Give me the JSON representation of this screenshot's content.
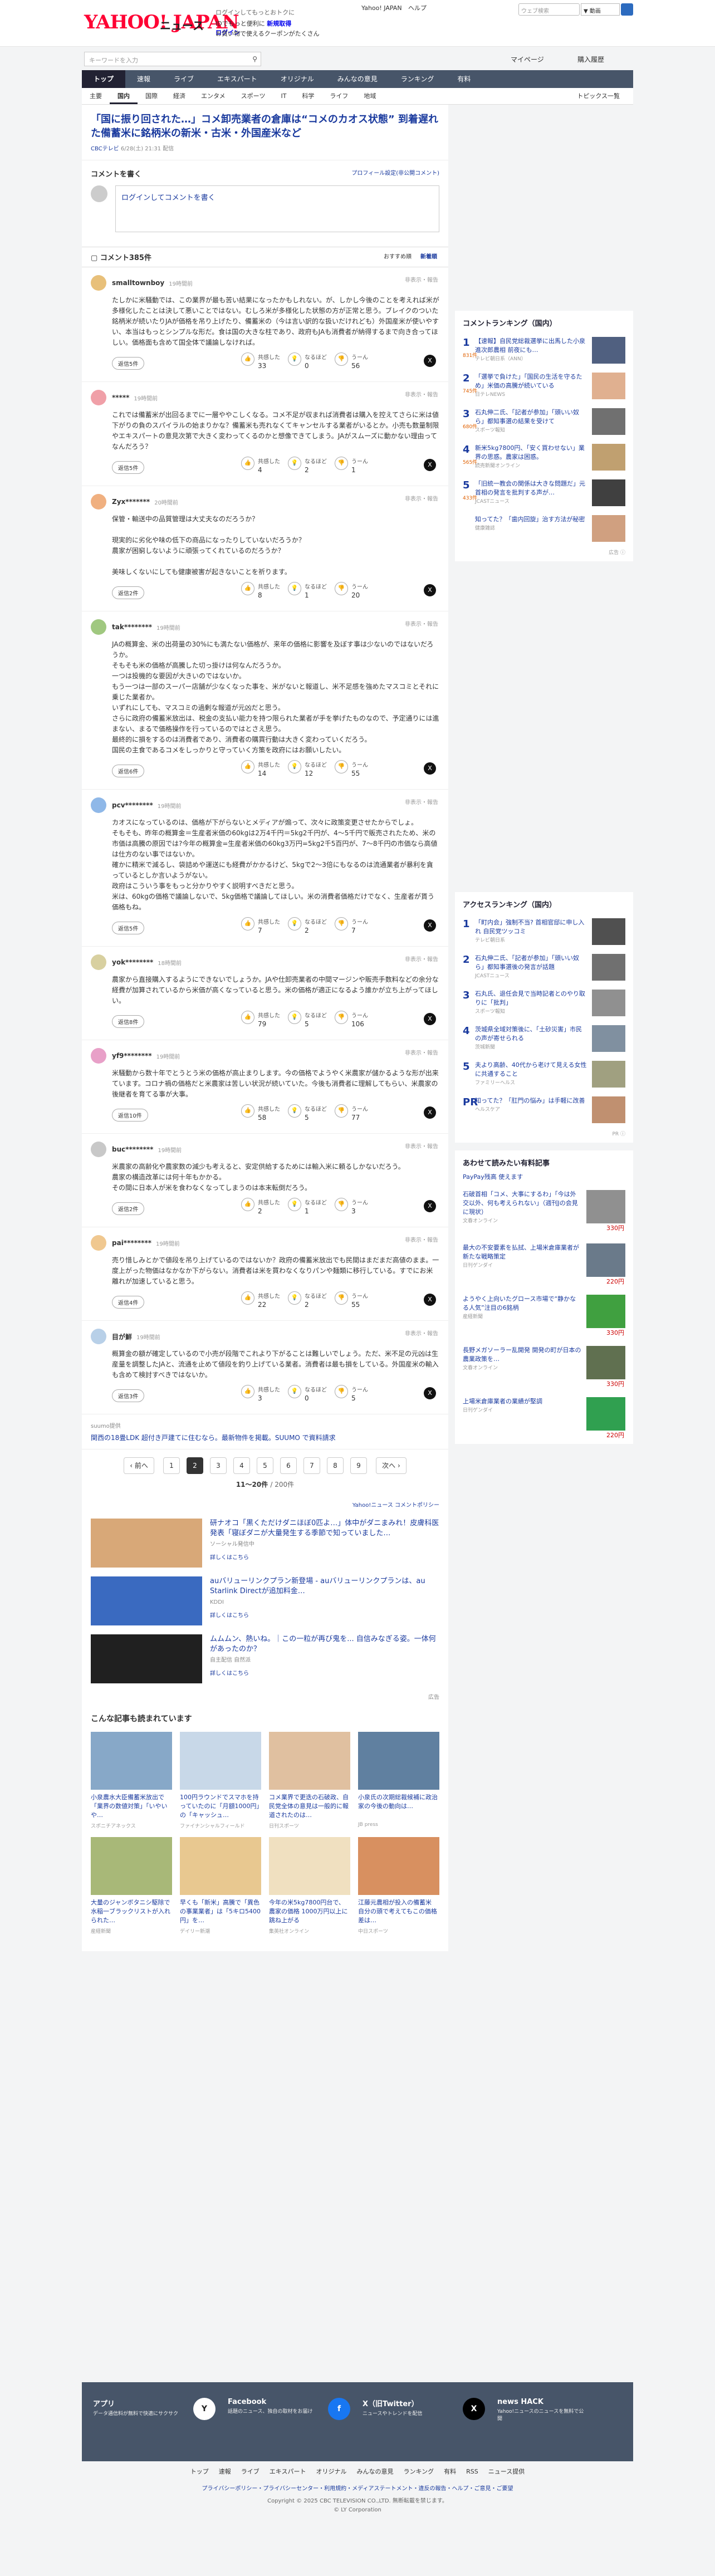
{
  "header": {
    "logo": "YAHOO! JAPAN",
    "logo_sub": "ニュース",
    "promo1": "ログインしてもっとおトクに",
    "promo2_link": "新規取得",
    "promo2_text": "IDでもっと便利に",
    "promo2_login": "ログイン",
    "promo3": "お買い物で使えるクーポンがたくさん",
    "top_links": [
      "Yahoo! JAPAN",
      "ヘルプ"
    ],
    "search_placeholder": "ウェブ検索",
    "search_select": "▼ 動画",
    "keyword_placeholder": "キーワードを入力",
    "mypage": "マイページ",
    "buy": "購入履歴"
  },
  "nav": {
    "items": [
      "トップ",
      "速報",
      "ライブ",
      "エキスパート",
      "オリジナル",
      "みんなの意見",
      "ランキング",
      "有料"
    ]
  },
  "subnav": {
    "items": [
      "主要",
      "国内",
      "国際",
      "経済",
      "エンタメ",
      "スポーツ",
      "IT",
      "科学",
      "ライフ",
      "地域"
    ],
    "topics": "トピックス一覧"
  },
  "article": {
    "title": "「国に振り回された…」コメ卸売業者の倉庫は“コメのカオス状態” 到着遅れた備蓄米に銘柄米の新米・古米・外国産米など",
    "source": "CBCテレビ",
    "date": "6/28(土) 21:31",
    "source_suffix": "配信"
  },
  "comment_write": {
    "heading": "コメントを書く",
    "policy": "プロフィール設定(非公開コメント)",
    "box": "ログインしてコメントを書く"
  },
  "comments_header": {
    "title": "コメント385件",
    "sort_rec": "おすすめ順",
    "sort_new": "新着順"
  },
  "labels": {
    "report": "非表示・報告",
    "agree": "共感した",
    "hmm": "なるほど",
    "dislike": "うーん",
    "x_icon": "X",
    "reply_prefix": "返信"
  },
  "comments": [
    {
      "user": "smalltownboy",
      "time": "19時間前",
      "avatar": "#e8c07a",
      "body": "たしかに米騒動では、この業界が最も苦い結果になったかもしれない。が、しかし今後のことを考えれば米が多様化したことは決して悪いことではない。むしろ米が多様化した状態の方が正常と思う。ブレイクのついた銘柄米が続いたりJAが価格を吊り上げたり、備蓄米の（今は言い訳的な扱いだけれども）外国産米が使いやすい、本当はもっとシンプルな形だ。食は国の大きな柱であり、政府もJAも消費者が納得するまで向き合ってほしい。価格面も含めて国全体で議論しなければ。",
      "replies": "返信5件",
      "agree": "33",
      "hmm": "0",
      "dislike": "56"
    },
    {
      "user": "*****",
      "time": "19時間前",
      "avatar": "#f0a0a8",
      "body": "これでは備蓄米が出回るまでに一層ややこしくなる。コメ不足が収まれば消費者は購入を控えてさらに米は値下がりの負のスパイラルの始まりかな？備蓄米も売れなくてキャンセルする業者がいるとか。小売も数量制限やエキスパートの意見次第で大きく変わってくるのかと想像できてしまう。JAがスムーズに動かない理由ってなんだろう？",
      "replies": "返信5件",
      "agree": "4",
      "hmm": "2",
      "dislike": "1"
    },
    {
      "user": "Zyx*******",
      "time": "20時間前",
      "avatar": "#f0b080",
      "body": "保管・輸送中の品質管理は大丈夫なのだろうか？\n\n現実的に劣化や味の低下の商品になったりしていないだろうか？\n農家が困窮しないように頑張ってくれているのだろうか？\n\n美味しくないにしても健康被害が起きないことを祈ります。",
      "replies": "返信2件",
      "agree": "8",
      "hmm": "1",
      "dislike": "20"
    },
    {
      "user": "tak********",
      "time": "19時間前",
      "avatar": "#a0c880",
      "body": "JAの概算金、米の出荷量の30%にも満たない価格が、来年の価格に影響を及ぼす事は少ないのではないだろうか。\nそもそも米の価格が高騰した切っ掛けは何なんだろうか。\n一つは投機的な要因が大きいのではないか。\nもう一つは一部のスーパー店舗が少なくなった事を、米がないと報道し、米不足感を強めたマスコミとそれに乗じた業者か。\nいずれにしても、マスコミの過剰な報道が元凶だと思う。\nさらに政府の備蓄米放出は、税金の支払い能力を持つ限られた業者が手を挙げたものなので、予定通りには進まない、まるで価格操作を行っているのではとさえ思う。\n最終的に損をするのは消費者であり、消費者の購買行動は大きく変わっていくだろう。\n国民の主食であるコメをしっかりと守っていく方策を政府にはお願いしたい。",
      "replies": "返信6件",
      "agree": "14",
      "hmm": "12",
      "dislike": "55"
    },
    {
      "user": "pcv********",
      "time": "19時間前",
      "avatar": "#8fb8e8",
      "body": "カオスになっているのは、価格が下がらないとメディアが煽って、次々に政策変更させたからでしょ。\nそもそも、昨年の概算金＝生産者米価の60kgは2万4千円＝5kg2千円が、4〜5千円で販売されたため、米の市価は高騰の原因では?今年の概算金=生産者米価の60kg3万円=5kg2千5百円が、7〜8千円の市価なら高値は仕方のない事ではないか。\n確かに精米で減るし、袋詰めや運送にも経費がかかるけど、5kgで2〜3倍にもなるのは流通業者が暴利を貪っているとしか言いようがない。\n政府はこういう事をもっと分かりやすく説明すべきだと思う。\n米は、60kgの価格で議論しないで、5kg価格で議論してほしい。米の消費者価格だけでなく、生産者が貰う価格もね。",
      "replies": "返信5件",
      "agree": "7",
      "hmm": "2",
      "dislike": "7"
    },
    {
      "user": "yok********",
      "time": "18時間前",
      "avatar": "#d8d0a0",
      "body": "農家から直接購入するようにできないでしょうか。JAや仕卸売業者の中間マージンや販売手数料などの余分な経費が加算されているから米価が高くなっていると思う。米の価格が適正になるよう誰かが立ち上がってほしい。",
      "replies": "返信8件",
      "agree": "79",
      "hmm": "5",
      "dislike": "106"
    },
    {
      "user": "yf9********",
      "time": "19時間前",
      "avatar": "#e8a0c8",
      "body": "米騒動から数十年でとうとう米の価格が高止まりします。今の価格でようやく米農家が儲かるような形が出来ています。コロナ禍の価格だと米農家は苦しい状況が続いていた。今後も消費者に理解してもらい、米農家の後継者を育てる事が大事。",
      "replies": "返信10件",
      "agree": "58",
      "hmm": "5",
      "dislike": "77"
    },
    {
      "user": "buc********",
      "time": "19時間前",
      "avatar": "#c8c8c8",
      "body": "米農家の高齢化や農家数の減少も考えると、安定供給するためには輸入米に頼るしかないだろう。\n農家の構造改革には何十年もかかる。\nその間に日本人が米を食わなくなってしまうのは本末転倒だろう。",
      "replies": "返信2件",
      "agree": "2",
      "hmm": "1",
      "dislike": "3"
    },
    {
      "user": "pai********",
      "time": "19時間前",
      "avatar": "#f0c890",
      "body": "売り惜しみとかで値段を吊り上げているのではないか？政府の備蓄米放出でも民間はまだまだ高値のまま。一度上がった物価はなかなか下がらない。消費者は米を買わなくなりパンや麺類に移行している。すでにお米離れが加速していると思う。",
      "replies": "返信4件",
      "agree": "22",
      "hmm": "2",
      "dislike": "55"
    },
    {
      "user": "目が鮮",
      "time": "19時間前",
      "avatar": "#b8d0e8",
      "body": "概算金の額が確定しているので小売が段階でこれより下がることは難しいでしょう。ただ、米不足の元凶は生産量を調整したJAと、流通を止めて値段を釣り上げている業者。消費者は最も損をしている。外国産米の輸入も含めて検討すべきではないか。",
      "replies": "返信3件",
      "agree": "3",
      "hmm": "0",
      "dislike": "5"
    }
  ],
  "ad_row": {
    "src": "suumo提供",
    "text": "関西の18畳LDK 超付き戸建てに住むなら。最新物件を掲載。SUUMO で資料請求",
    "pr": "PR"
  },
  "pager": {
    "prev": "前へ",
    "next": "次へ",
    "pages": [
      "1",
      "2",
      "3",
      "4",
      "5",
      "6",
      "7",
      "8",
      "9"
    ],
    "current": "2",
    "range": "11〜20件",
    "total": "/ 200件"
  },
  "sponsored": {
    "header": "Yahoo!ニュース コメントポリシー",
    "items": [
      {
        "title": "研ナオコ「黒くただけダニほぼ0匹よ…」体中がダニまみれ！皮膚科医発表「寝ぼダニが大量発生する季節で知っていました…",
        "source": "ソーシャル発信中",
        "link": "詳しくはこちら",
        "color": "#d8a878"
      },
      {
        "title": "auバリューリンクプラン新登場 - auバリューリンクプランは、au Starlink Directが追加料金…",
        "source": "KDDI",
        "link": "詳しくはこちら",
        "color": "#3a6ac0"
      },
      {
        "title": "ムムムン、熱いね。｜この一粒が再び鬼を... 自信みなぎる姿。一体何があったのか？",
        "source": "自主配信 自然派",
        "link": "詳しくはこちら",
        "color": "#202020"
      }
    ],
    "footer": "広告"
  },
  "recommend": {
    "title": "こんな記事も読まれています",
    "items": [
      {
        "t": "小泉農水大臣備蓄米放出で「業界の数値対策」「いやいや…",
        "s": "スポニチアネックス",
        "c": "#87a8c8"
      },
      {
        "t": "100円ラウンドでスマホを持っていたのに「月額1000円」の「キャッシュ…",
        "s": "ファイナンシャルフィールド",
        "c": "#c8d8e8"
      },
      {
        "t": "コメ業界で更迭の石破政、自民党全体の意見は一般的に報道されたのは…",
        "s": "日刊スポーツ",
        "c": "#e0c0a0"
      },
      {
        "t": "小泉氏の次期総裁候補に政治家の今後の動向は…",
        "s": "JB press",
        "c": "#6080a0"
      },
      {
        "t": "大量のジャンボタニシ駆除で水稲一ブラックリストが入れられた…",
        "s": "産経新聞",
        "c": "#a8b878"
      },
      {
        "t": "早くも「新米」高騰で「異色の事業業者」は「5キロ5400円」を…",
        "s": "デイリー新潮",
        "c": "#e8c890"
      },
      {
        "t": "今年の米5kg7800円台で、農家の価格 1000万円以上に跳ね上がる",
        "s": "集英社オンライン",
        "c": "#f0e0c0"
      },
      {
        "t": "江藤元農相が投入の備蓄米 自分の頭で考えてもこの価格差は…",
        "s": "中日スポーツ",
        "c": "#d89060"
      }
    ]
  },
  "sidebar": {
    "ranking_title": "コメントランキング（国内）",
    "ranking": [
      {
        "no": "1",
        "cnt": "831件",
        "title": "【速報】自民党総裁選挙に出馬した小泉進次郎農相 前夜にも…",
        "src": "テレビ朝日系（ANN）",
        "c": "#506080"
      },
      {
        "no": "2",
        "cnt": "745件",
        "title": "「選挙で負けた」「国民の生活を守るため」米価の高騰が続いている",
        "src": "日テレNEWS",
        "c": "#e0b090"
      },
      {
        "no": "3",
        "cnt": "680件",
        "title": "石丸伸二氏、「記者が参加」「頭いい奴ら」都知事選の結果を受けて",
        "src": "スポーツ報知",
        "c": "#707070"
      },
      {
        "no": "4",
        "cnt": "565件",
        "title": "新米5kg7800円、「安く買わせない」業界の思惑。農家は困惑。",
        "src": "読売新聞オンライン",
        "c": "#c0a070"
      },
      {
        "no": "5",
        "cnt": "433件",
        "title": "「旧統一教会の関係は大きな問題だ」元首相の発言を批判する声が…",
        "src": "JCASTニュース",
        "c": "#404040"
      },
      {
        "no": "",
        "cnt": "",
        "title": "知ってた？「歯内回旋」治す方法が秘密",
        "src": "健康雑誌",
        "c": "#d0a080"
      }
    ],
    "access_title": "アクセスランキング（国内）",
    "access": [
      {
        "no": "1",
        "title": "「町内会」強制不当? 首相官邸に申し入れ 自民党ツッコミ",
        "src": "テレビ朝日系",
        "c": "#505050"
      },
      {
        "no": "2",
        "title": "石丸伸二氏、「記者が参加」「頭いい奴ら」都知事選後の発言が話題",
        "src": "JCASTニュース",
        "c": "#707070"
      },
      {
        "no": "3",
        "title": "石丸氏、退任会見で当時記者とのやり取りに「批判」",
        "src": "スポーツ報知",
        "c": "#909090"
      },
      {
        "no": "4",
        "title": "茨城県全域対策後に、「土砂災害」市民の声が寄せられる",
        "src": "茨城新聞",
        "c": "#8090a0"
      },
      {
        "no": "5",
        "title": "夫より高齢、40代から老けて見える女性に共通すること",
        "src": "ファミリーヘルス",
        "c": "#a0a080"
      },
      {
        "no": "PR",
        "title": "知ってた？「肛門の悩み」は手軽に改善",
        "src": "ヘルスケア",
        "c": "#c09070"
      }
    ],
    "ad_title": "あわせて読みたい有料記事",
    "ad_sub": "PayPay残高 使えます",
    "ads": [
      {
        "title": "石破首相「コメ、大事にするわ」「今は外交以外、何も考えられない」（週刊Jの会見に現状）",
        "src": "文春オンライン",
        "price": "330円",
        "c": "#909090"
      },
      {
        "title": "最大の不安要素を払拭、上場米倉庫業者が新たな戦略策定",
        "src": "日刊ゲンダイ",
        "price": "220円",
        "c": "#6a7a8a"
      },
      {
        "title": "ようやく上向いたグロース市場で“静かなる人気”注目の6銘柄",
        "src": "産経新聞",
        "price": "330円",
        "c": "#40a040"
      },
      {
        "title": "長野メガソーラー乱開発 開発の町が日本の農業政策を…",
        "src": "文春オンライン",
        "price": "330円",
        "c": "#607050"
      },
      {
        "title": "上場米倉庫業者の業績が堅調",
        "src": "日刊ゲンダイ",
        "price": "220円",
        "c": "#30a050"
      }
    ]
  },
  "footer": {
    "cols": [
      {
        "title": "アプリ",
        "desc": "データ通信料が無料で快適にサクサク",
        "icon": "Y"
      },
      {
        "title": "Facebook",
        "desc": "話題のニュース、独自の取材をお届け",
        "icon": "f"
      },
      {
        "title": "X（旧Twitter）",
        "desc": "ニュースやトレンドを配信",
        "icon": "X"
      },
      {
        "title": "news HACK",
        "desc": "Yahoo!ニュースのニュースを無料で公開",
        "icon": ""
      }
    ],
    "links": [
      "トップ",
      "速報",
      "ライブ",
      "エキスパート",
      "オリジナル",
      "みんなの意見",
      "ランキング",
      "有料",
      "RSS",
      "ニュース提供"
    ],
    "privacy": "プライバシーポリシー・プライバシーセンター・利用規約・メディアステートメント・違反の報告・ヘルプ・ご意見・ご要望",
    "copyright": "Copyright © 2025 CBC TELEVISION CO.,LTD. 無断転載を禁じます。",
    "copyright2": "© LY Corporation"
  }
}
